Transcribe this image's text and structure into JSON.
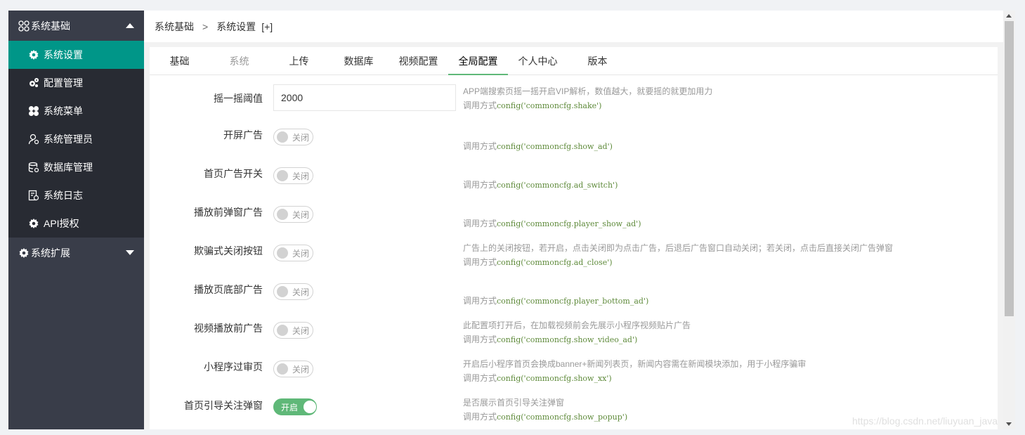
{
  "sidebar": {
    "group1": {
      "label": "系统基础",
      "icon": "apps-icon"
    },
    "items": [
      {
        "label": "系统设置",
        "icon": "gear-icon",
        "active": true
      },
      {
        "label": "配置管理",
        "icon": "gears-icon"
      },
      {
        "label": "系统菜单",
        "icon": "menu-icon"
      },
      {
        "label": "系统管理员",
        "icon": "user-icon"
      },
      {
        "label": "数据库管理",
        "icon": "database-icon"
      },
      {
        "label": "系统日志",
        "icon": "log-icon"
      },
      {
        "label": "API授权",
        "icon": "gear-icon"
      }
    ],
    "group2": {
      "label": "系统扩展",
      "icon": "gear-icon"
    }
  },
  "breadcrumb": {
    "item1": "系统基础",
    "separator": ">",
    "item2": "系统设置",
    "extra": "[+]"
  },
  "tabs": [
    "基础",
    "系统",
    "上传",
    "数据库",
    "视频配置",
    "全局配置",
    "个人中心",
    "版本"
  ],
  "active_tab": "全局配置",
  "fields": [
    {
      "label": "摇一摇阈值",
      "type": "input",
      "value": "2000",
      "desc": "APP端搜索页摇一摇开启VIP解析，数值越大，就要摇的就更加用力",
      "call_prefix": "调用方式",
      "code": "config('commoncfg.shake')"
    },
    {
      "label": "开屏广告",
      "type": "switch",
      "state": "关闭",
      "on": false,
      "desc": "",
      "call_prefix": "调用方式",
      "code": "config('commoncfg.show_ad')"
    },
    {
      "label": "首页广告开关",
      "type": "switch",
      "state": "关闭",
      "on": false,
      "desc": "",
      "call_prefix": "调用方式",
      "code": "config('commoncfg.ad_switch')"
    },
    {
      "label": "播放前弹窗广告",
      "type": "switch",
      "state": "关闭",
      "on": false,
      "desc": "",
      "call_prefix": "调用方式",
      "code": "config('commoncfg.player_show_ad')"
    },
    {
      "label": "欺骗式关闭按钮",
      "type": "switch",
      "state": "关闭",
      "on": false,
      "desc": "广告上的关闭按钮，若开启，点击关闭即为点击广告，后退后广告窗口自动关闭；若关闭，点击后直接关闭广告弹窗",
      "call_prefix": "调用方式",
      "code": "config('commoncfg.ad_close')"
    },
    {
      "label": "播放页底部广告",
      "type": "switch",
      "state": "关闭",
      "on": false,
      "desc": "",
      "call_prefix": "调用方式",
      "code": "config('commoncfg.player_bottom_ad')"
    },
    {
      "label": "视频播放前广告",
      "type": "switch",
      "state": "关闭",
      "on": false,
      "desc": "此配置项打开后，在加载视频前会先展示小程序视频贴片广告",
      "call_prefix": "调用方式",
      "code": "config('commoncfg.show_video_ad')"
    },
    {
      "label": "小程序过审页",
      "type": "switch",
      "state": "关闭",
      "on": false,
      "desc": "开启后小程序首页会换成banner+新闻列表页，新闻内容需在新闻模块添加，用于小程序骗审",
      "call_prefix": "调用方式",
      "code": "config('commoncfg.show_xx')"
    },
    {
      "label": "首页引导关注弹窗",
      "type": "switch",
      "state": "开启",
      "on": true,
      "desc": "是否展示首页引导关注弹窗",
      "call_prefix": "调用方式",
      "code": "config('commoncfg.show_popup')"
    }
  ],
  "watermark": "https://blog.csdn.net/liuyuan_java",
  "colors": {
    "sidebar": "#393d49",
    "active": "#009688",
    "switch_on": "#5fb878"
  }
}
